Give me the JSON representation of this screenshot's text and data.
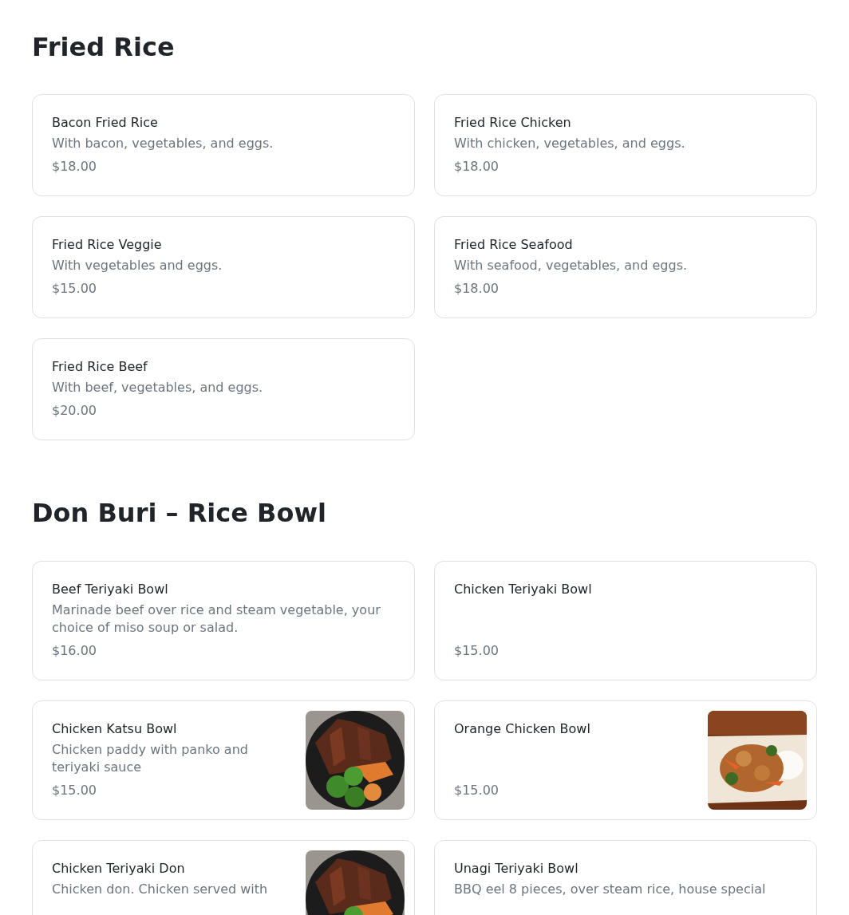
{
  "sections": [
    {
      "title": "Fried Rice",
      "items": [
        {
          "kind": "plain",
          "name": "Bacon Fried Rice",
          "description": "With bacon, vegetables, and eggs.",
          "price": "$18.00"
        },
        {
          "kind": "plain",
          "name": "Fried Rice Chicken",
          "description": "With chicken, vegetables, and eggs.",
          "price": "$18.00"
        },
        {
          "kind": "plain",
          "name": "Fried Rice Veggie",
          "description": "With vegetables and eggs.",
          "price": "$15.00"
        },
        {
          "kind": "plain",
          "name": "Fried Rice Seafood",
          "description": "With seafood, vegetables, and eggs.",
          "price": "$18.00"
        },
        {
          "kind": "plain",
          "name": "Fried Rice Beef",
          "description": "With beef, vegetables, and eggs.",
          "price": "$20.00"
        }
      ]
    },
    {
      "title": "Don Buri – Rice Bowl",
      "items": [
        {
          "kind": "plain",
          "name": "Beef Teriyaki Bowl",
          "description": "Marinade beef over rice and steam vegetable, your choice of miso soup or salad.",
          "price": "$16.00"
        },
        {
          "kind": "plain",
          "name": "Chicken Teriyaki Bowl",
          "price": "$15.00"
        },
        {
          "kind": "bowl",
          "name": "Chicken Katsu Bowl",
          "description": "Chicken paddy with panko and teriyaki sauce",
          "price": "$15.00"
        },
        {
          "kind": "plate",
          "name": "Orange Chicken Bowl",
          "price": "$15.00"
        },
        {
          "kind": "bowl",
          "name": "Chicken Teriyaki Don",
          "description": "Chicken don. Chicken served with"
        },
        {
          "kind": "plain",
          "name": "Unagi Teriyaki Bowl",
          "description": "BBQ eel 8 pieces, over steam rice, house special"
        }
      ]
    }
  ]
}
